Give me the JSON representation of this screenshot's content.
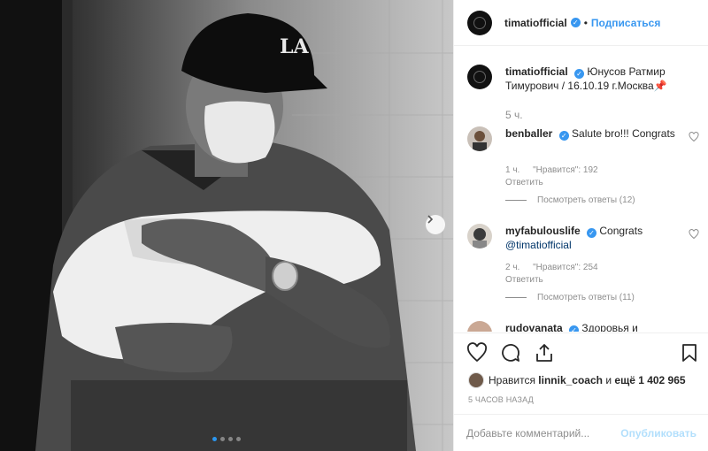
{
  "header": {
    "username": "timatiofficial",
    "separator": "•",
    "follow_label": "Подписаться"
  },
  "caption": {
    "username": "timatiofficial",
    "text": "Юнусов Ратмир Тимурович / 16.10.19 г.Москва",
    "emoji": "📌",
    "time": "5 ч."
  },
  "comments": [
    {
      "username": "benballer",
      "text": "Salute bro!!! Congrats",
      "time": "1 ч.",
      "likes": "\"Нравится\": 192",
      "reply_label": "Ответить",
      "view_replies": "Посмотреть ответы (12)"
    },
    {
      "username": "myfabulouslife",
      "text": "Congrats",
      "mention": "@timatiofficial",
      "time": "2 ч.",
      "likes": "\"Нравится\": 254",
      "reply_label": "Ответить",
      "view_replies": "Посмотреть ответы (11)"
    },
    {
      "username": "rudovanata",
      "text": "Здоровья и"
    }
  ],
  "likes": {
    "prefix": "Нравится",
    "user": "linnik_coach",
    "middle": "и",
    "rest": "ещё 1 402 965"
  },
  "posted_time": "5 ЧАСОВ НАЗАД",
  "add_comment": {
    "placeholder": "Добавьте комментарий...",
    "publish_label": "Опубликовать"
  },
  "carousel": {
    "total": 4,
    "active": 1
  },
  "icons": {
    "like": "heart-icon",
    "comment": "comment-icon",
    "share": "share-icon",
    "save": "bookmark-icon",
    "next": "chevron-right-icon",
    "verified": "verified-badge-icon"
  },
  "colors": {
    "accent": "#3897f0",
    "publish_disabled": "#b2dffc",
    "muted": "#8e8e8e"
  }
}
